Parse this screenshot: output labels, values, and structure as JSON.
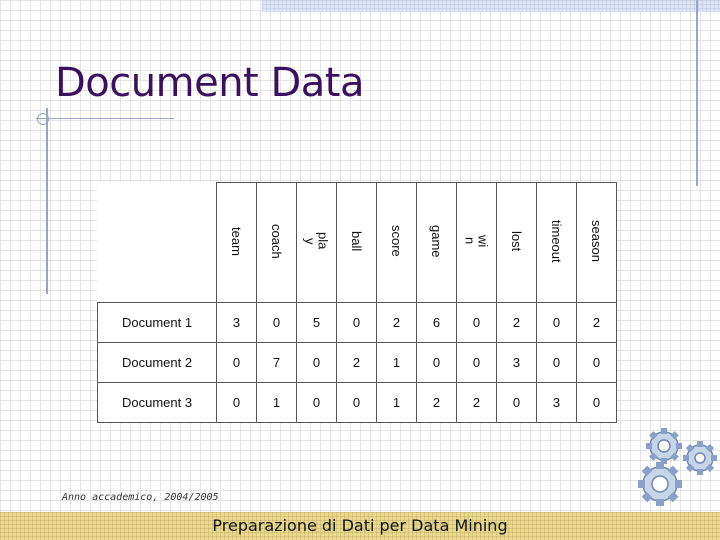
{
  "slide": {
    "title": "Document Data",
    "footer_left": "Anno accademico, 2004/2005",
    "footer_center": "Preparazione di Dati per Data Mining"
  },
  "table": {
    "terms": [
      "team",
      "coach",
      "pla\ny",
      "ball",
      "score",
      "game",
      "wi\nn",
      "lost",
      "timeout",
      "season"
    ],
    "rows": [
      {
        "label": "Document 1",
        "values": [
          3,
          0,
          5,
          0,
          2,
          6,
          0,
          2,
          0,
          2
        ]
      },
      {
        "label": "Document 2",
        "values": [
          0,
          7,
          0,
          2,
          1,
          0,
          0,
          3,
          0,
          0
        ]
      },
      {
        "label": "Document 3",
        "values": [
          0,
          1,
          0,
          0,
          1,
          2,
          2,
          0,
          3,
          0
        ]
      }
    ]
  },
  "icons": {
    "gears": "gears-icon"
  }
}
